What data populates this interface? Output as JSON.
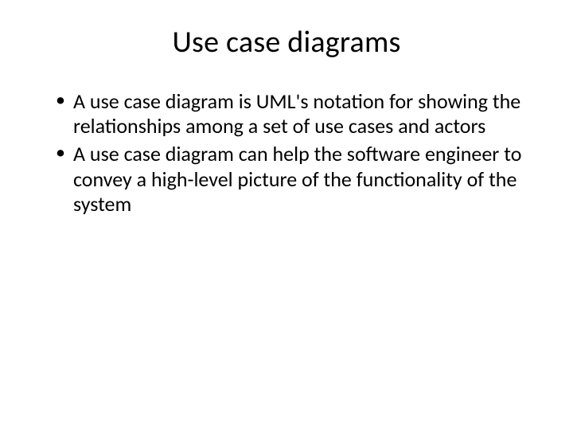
{
  "slide": {
    "title": "Use case diagrams",
    "bullets": [
      "A use case diagram is UML's notation for showing the relationships among a set of use cases and actors",
      "A use case diagram can help the software engineer to convey a high-level picture of the functionality of the system"
    ]
  }
}
